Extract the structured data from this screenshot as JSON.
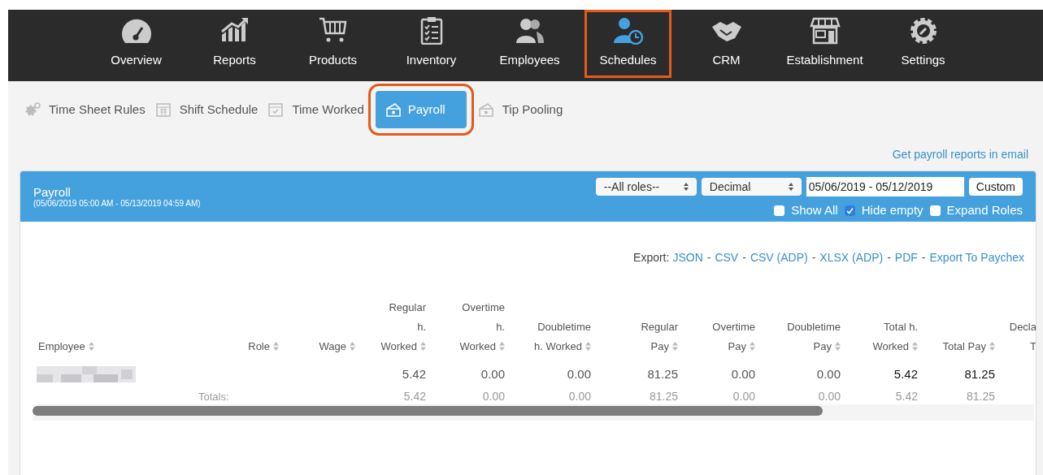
{
  "nav": {
    "items": [
      {
        "label": "Overview",
        "selected": false
      },
      {
        "label": "Reports",
        "selected": false
      },
      {
        "label": "Products",
        "selected": false
      },
      {
        "label": "Inventory",
        "selected": false
      },
      {
        "label": "Employees",
        "selected": false
      },
      {
        "label": "Schedules",
        "selected": true
      },
      {
        "label": "CRM",
        "selected": false
      },
      {
        "label": "Establishment",
        "selected": false
      },
      {
        "label": "Settings",
        "selected": false
      }
    ]
  },
  "subnav": {
    "tabs": [
      {
        "label": "Time Sheet Rules",
        "selected": false
      },
      {
        "label": "Shift Schedule",
        "selected": false
      },
      {
        "label": "Time Worked",
        "selected": false
      },
      {
        "label": "Payroll",
        "selected": true
      },
      {
        "label": "Tip Pooling",
        "selected": false
      }
    ]
  },
  "email_link": "Get payroll reports in email",
  "panel": {
    "title": "Payroll",
    "period": "(05/06/2019 05:00 AM - 05/13/2019 04:59 AM)",
    "role_select": "--All roles--",
    "format_select": "Decimal",
    "date_range": "05/06/2019 - 05/12/2019",
    "custom_button": "Custom",
    "checkboxes": [
      {
        "label": "Show All",
        "checked": false
      },
      {
        "label": "Hide empty",
        "checked": true
      },
      {
        "label": "Expand Roles",
        "checked": false
      }
    ],
    "export": {
      "label": "Export:",
      "separator": "-",
      "links": [
        "JSON",
        "CSV",
        "CSV (ADP)",
        "XLSX (ADP)",
        "PDF",
        "Export To Paychex"
      ]
    },
    "table": {
      "columns": [
        {
          "lines": [
            "Employee"
          ],
          "kind": "text",
          "sortable": true
        },
        {
          "lines": [
            "Role"
          ],
          "kind": "number",
          "sortable": true
        },
        {
          "lines": [
            "Wage"
          ],
          "kind": "number",
          "sortable": true
        },
        {
          "lines": [
            "Regular",
            "h.",
            "Worked"
          ],
          "kind": "number",
          "sortable": true
        },
        {
          "lines": [
            "Overtime",
            "h.",
            "Worked"
          ],
          "kind": "number",
          "sortable": true
        },
        {
          "lines": [
            "Doubletime",
            "h. Worked"
          ],
          "kind": "number",
          "sortable": true
        },
        {
          "lines": [
            "Regular",
            "Pay"
          ],
          "kind": "number",
          "sortable": true
        },
        {
          "lines": [
            "Overtime",
            "Pay"
          ],
          "kind": "number",
          "sortable": true
        },
        {
          "lines": [
            "Doubletime",
            "Pay"
          ],
          "kind": "number",
          "sortable": true
        },
        {
          "lines": [
            "Total h.",
            "Worked"
          ],
          "kind": "total",
          "sortable": true
        },
        {
          "lines": [
            "Total Pay"
          ],
          "kind": "total",
          "sortable": true
        },
        {
          "lines": [
            "Decla",
            "T"
          ],
          "kind": "cut",
          "sortable": false
        }
      ],
      "rows": [
        {
          "values": [
            "5.42",
            "0.00",
            "0.00",
            "81.25",
            "0.00",
            "0.00",
            "5.42",
            "81.25"
          ]
        }
      ],
      "totals": {
        "label": "Totals:",
        "values": [
          "5.42",
          "0.00",
          "0.00",
          "81.25",
          "0.00",
          "0.00",
          "5.42",
          "81.25"
        ]
      }
    }
  }
}
